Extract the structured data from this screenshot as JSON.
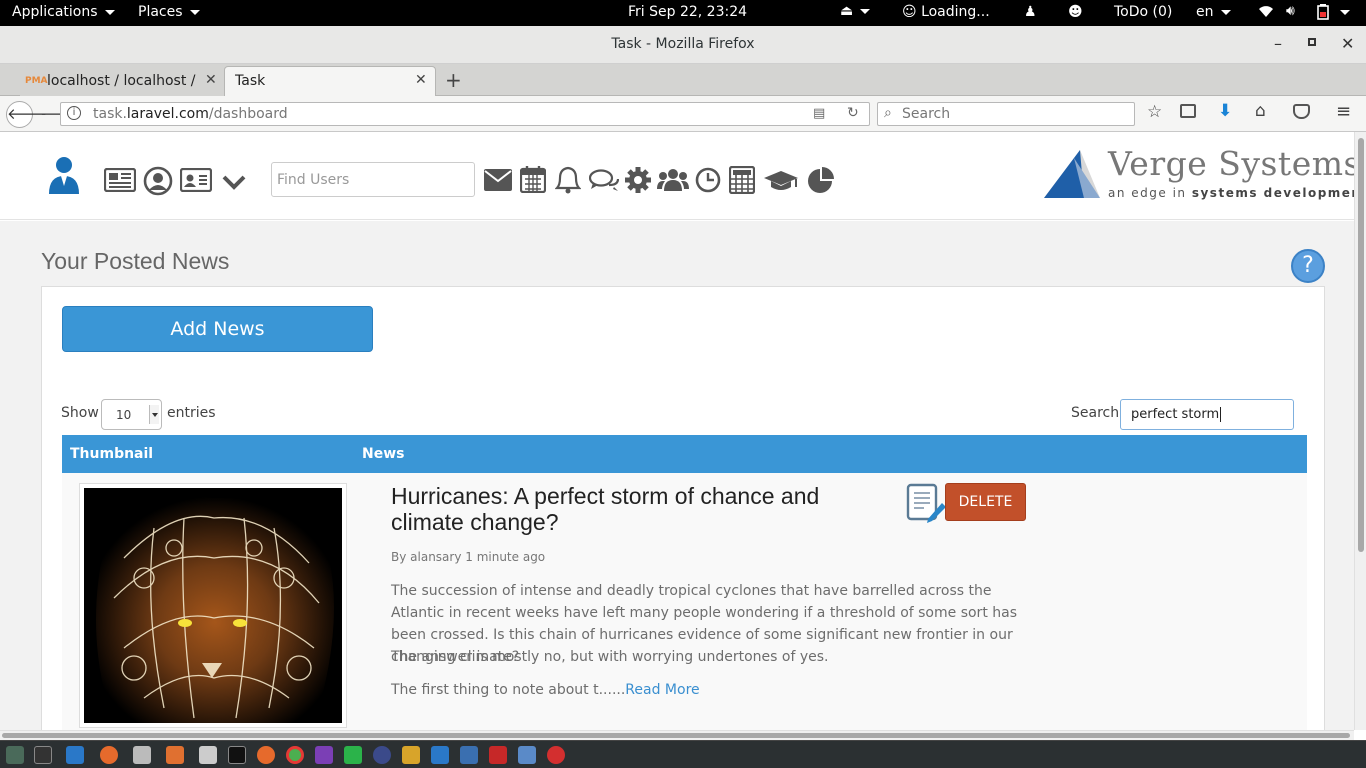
{
  "topbar": {
    "applications": "Applications",
    "places": "Places",
    "clock": "Fri Sep 22, 23:24",
    "status": "Loading...",
    "todo": "ToDo (0)",
    "lang": "en"
  },
  "window": {
    "title": "Task - Mozilla Firefox"
  },
  "tabs": [
    {
      "label": "localhost / localhost /..."
    },
    {
      "label": "Task"
    }
  ],
  "navbar": {
    "url_prefix": "task.",
    "url_domain": "laravel.com",
    "url_path": "/dashboard",
    "search_placeholder": "Search"
  },
  "app": {
    "find_users_placeholder": "Find Users",
    "logo_name": "Verge Systems",
    "logo_tagline_a": "an edge in ",
    "logo_tagline_b": "systems development",
    "page_title": "Your Posted News",
    "help_label": "?",
    "add_news": "Add News",
    "show_label": "Show",
    "entries_value": "10",
    "entries_label": "entries",
    "search_label": "Search:",
    "search_value": "perfect storm"
  },
  "table": {
    "col_thumbnail": "Thumbnail",
    "col_news": "News",
    "rows": [
      {
        "title": "Hurricanes: A perfect storm of chance and climate change?",
        "meta": "By alansary 1 minute ago",
        "p1": "The succession of intense and deadly tropical cyclones that have barrelled across the Atlantic in recent weeks have left many people wondering if a threshold of some sort has been crossed. Is this chain of hurricanes evidence of some significant new frontier in our changing climate?",
        "p2": "The answer is mostly no, but with worrying undertones of yes.",
        "p3": "The first thing to note about t......",
        "read_more": "Read More",
        "delete": "DELETE"
      }
    ]
  },
  "colors": {
    "accent": "#3a96d6",
    "delete": "#c2502a",
    "logo_blue": "#1f5fa8"
  }
}
